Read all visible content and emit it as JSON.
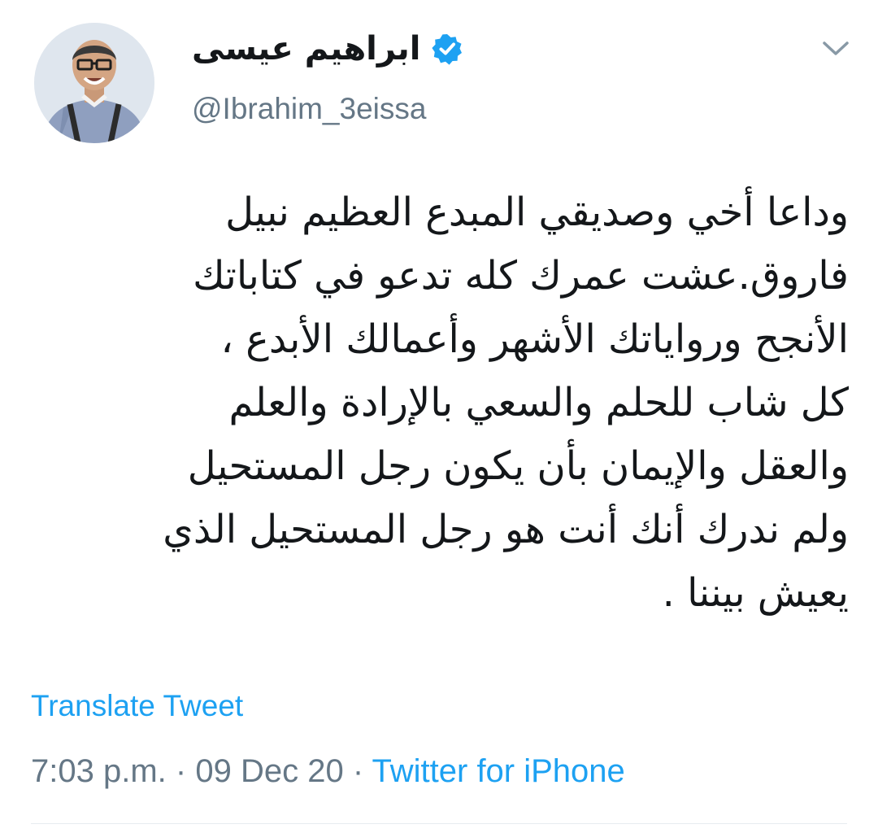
{
  "user": {
    "display_name": "ابراهيم عيسى",
    "handle": "@Ibrahim_3eissa",
    "verified_icon": "verified-badge-icon",
    "avatar": "profile-photo"
  },
  "menu": {
    "icon": "chevron-down-icon"
  },
  "tweet": {
    "lines": [
      "وداعا أخي وصديقي المبدع العظيم نبيل",
      "فاروق.عشت عمرك كله تدعو في كتاباتك",
      "الأنجح ورواياتك الأشهر وأعمالك الأبدع ،",
      "كل شاب للحلم والسعي بالإرادة والعلم",
      "والعقل والإيمان بأن يكون رجل المستحيل",
      "ولم ندرك أنك أنت هو رجل المستحيل الذي",
      "يعيش بيننا ."
    ]
  },
  "translate_label": "Translate Tweet",
  "meta": {
    "time": "7:03 p.m.",
    "separator": "·",
    "date": "09 Dec 20",
    "source": "Twitter for iPhone"
  },
  "colors": {
    "accent": "#1da1f2",
    "secondary_text": "#657786",
    "primary_text": "#14171a"
  }
}
